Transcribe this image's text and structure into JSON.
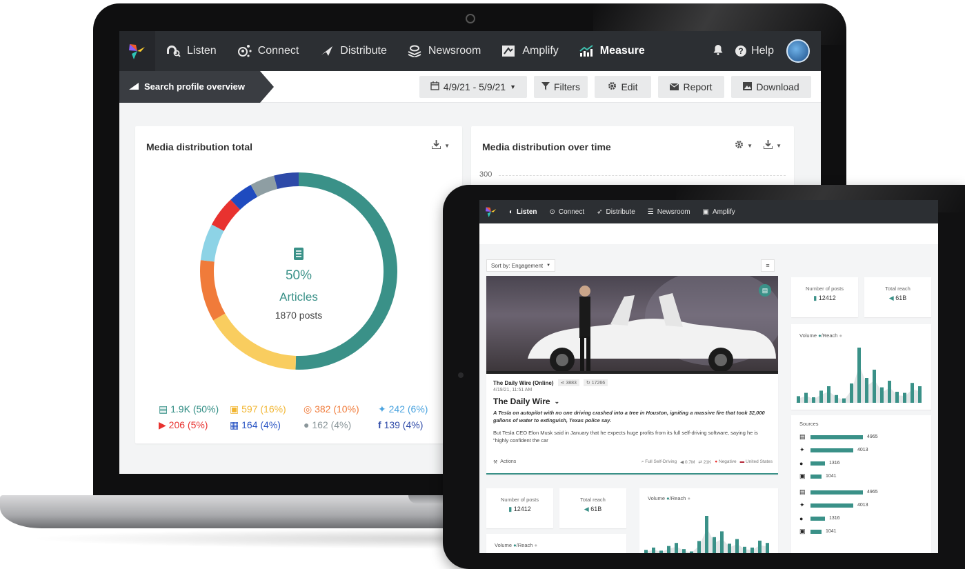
{
  "colors": {
    "nav_bg": "#2c2f33",
    "accent_teal": "#3a9188",
    "donut": [
      "#3a9188",
      "#f9cd5f",
      "#f07b3a",
      "#8dd3e6",
      "#e8322f",
      "#1f4bbf",
      "#8e9ea3",
      "#2e4aa8"
    ]
  },
  "laptop": {
    "nav": {
      "items": [
        {
          "label": "Listen",
          "icon": "listen-icon"
        },
        {
          "label": "Connect",
          "icon": "connect-icon"
        },
        {
          "label": "Distribute",
          "icon": "distribute-icon"
        },
        {
          "label": "Newsroom",
          "icon": "newsroom-icon"
        },
        {
          "label": "Amplify",
          "icon": "amplify-icon"
        },
        {
          "label": "Measure",
          "icon": "measure-icon"
        }
      ],
      "help_label": "Help"
    },
    "subbar": {
      "breadcrumb": "Search profile overview",
      "date_range": "4/9/21 - 5/9/21",
      "filters_label": "Filters",
      "edit_label": "Edit",
      "report_label": "Report",
      "download_label": "Download"
    },
    "media_total": {
      "title": "Media distribution total",
      "center_percent": "50%",
      "center_type": "Articles",
      "center_posts": "1870 posts",
      "legend": [
        {
          "text": "1.9K (50%)",
          "color": "#2f8c83"
        },
        {
          "text": "597 (16%)",
          "color": "#f2b632"
        },
        {
          "text": "382 (10%)",
          "color": "#f07b3a"
        },
        {
          "text": "242 (6%)",
          "color": "#4aa3df"
        },
        {
          "text": "206 (5%)",
          "color": "#e8322f"
        },
        {
          "text": "164 (4%)",
          "color": "#2a55c4"
        },
        {
          "text": "162 (4%)",
          "color": "#8a969a"
        },
        {
          "text": "139 (4%)",
          "color": "#2e4aa8"
        }
      ]
    },
    "media_over_time": {
      "title": "Media distribution over time",
      "y_tick": "300"
    }
  },
  "tablet": {
    "nav": {
      "items": [
        {
          "label": "Listen"
        },
        {
          "label": "Connect"
        },
        {
          "label": "Distribute"
        },
        {
          "label": "Newsroom"
        },
        {
          "label": "Amplify"
        }
      ]
    },
    "sort_label": "Sort by: Engagement",
    "article": {
      "source": "The Daily Wire (Online)",
      "shares": "3883",
      "engagements": "17266",
      "datetime": "4/19/21, 11:51 AM",
      "outlet": "The Daily Wire",
      "lede": "A Tesla on autopilot with no one driving crashed into a tree in Houston, igniting a massive fire that took 32,000 gallons of water to extinguish, Texas police say.",
      "body": "But Tesla CEO Elon Musk said in January that he expects huge profits from its full self-driving software, saying he is \"highly confident the car",
      "actions_label": "Actions",
      "tags": {
        "keyword": "Full Self-Driving",
        "reach": "0.7M",
        "engagement": "21K",
        "sentiment": "Negative",
        "country": "United States"
      }
    },
    "stats": {
      "posts_label": "Number of posts",
      "posts_value": "12412",
      "reach_label": "Total reach",
      "reach_value": "61B"
    },
    "volume_title": "Volume",
    "reach_title": "/Reach",
    "volume_bars": [
      0.12,
      0.18,
      0.1,
      0.22,
      0.3,
      0.14,
      0.08,
      0.35,
      1.0,
      0.45,
      0.6,
      0.28,
      0.4,
      0.2,
      0.18,
      0.36,
      0.3
    ],
    "sources_title": "Sources",
    "sources": [
      {
        "icon": "article-icon",
        "value": "4965",
        "fraction": 1.0
      },
      {
        "icon": "twitter-icon",
        "value": "4013",
        "fraction": 0.81
      },
      {
        "icon": "comment-icon",
        "value": "1316",
        "fraction": 0.27
      },
      {
        "icon": "blog-icon",
        "value": "1041",
        "fraction": 0.21
      }
    ]
  }
}
